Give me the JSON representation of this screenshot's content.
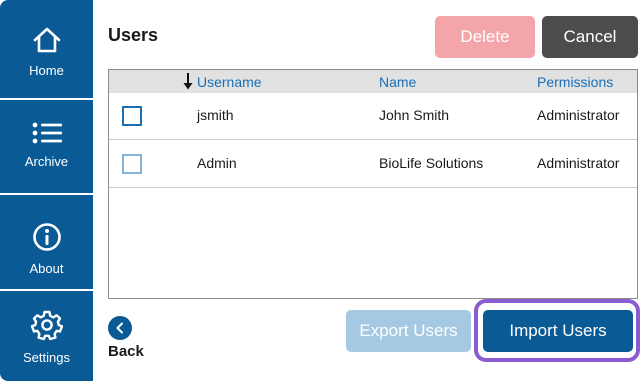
{
  "sidebar": {
    "items": [
      {
        "label": "Home",
        "icon": "home-icon"
      },
      {
        "label": "Archive",
        "icon": "list-icon"
      },
      {
        "label": "About",
        "icon": "info-icon"
      },
      {
        "label": "Settings",
        "icon": "gear-icon"
      }
    ]
  },
  "header": {
    "title": "Users",
    "delete_label": "Delete",
    "cancel_label": "Cancel"
  },
  "table": {
    "columns": [
      "Username",
      "Name",
      "Permissions"
    ],
    "sort": {
      "column": "Username",
      "icon": "sort-down-arrow-icon"
    },
    "rows": [
      {
        "username": "jsmith",
        "name": "John Smith",
        "permissions": "Administrator",
        "checked": false
      },
      {
        "username": "Admin",
        "name": "BioLife Solutions",
        "permissions": "Administrator",
        "checked": false
      }
    ]
  },
  "footer": {
    "back_label": "Back",
    "export_label": "Export Users",
    "import_label": "Import Users"
  },
  "colors": {
    "sidebar": "#0a5a96",
    "delete": "#f4a5a9",
    "cancel": "#4c4c4c",
    "export_disabled": "#a5c9e2",
    "import": "#0a5a96",
    "highlight": "#8a5cd0",
    "header_link": "#1a6fb8"
  }
}
